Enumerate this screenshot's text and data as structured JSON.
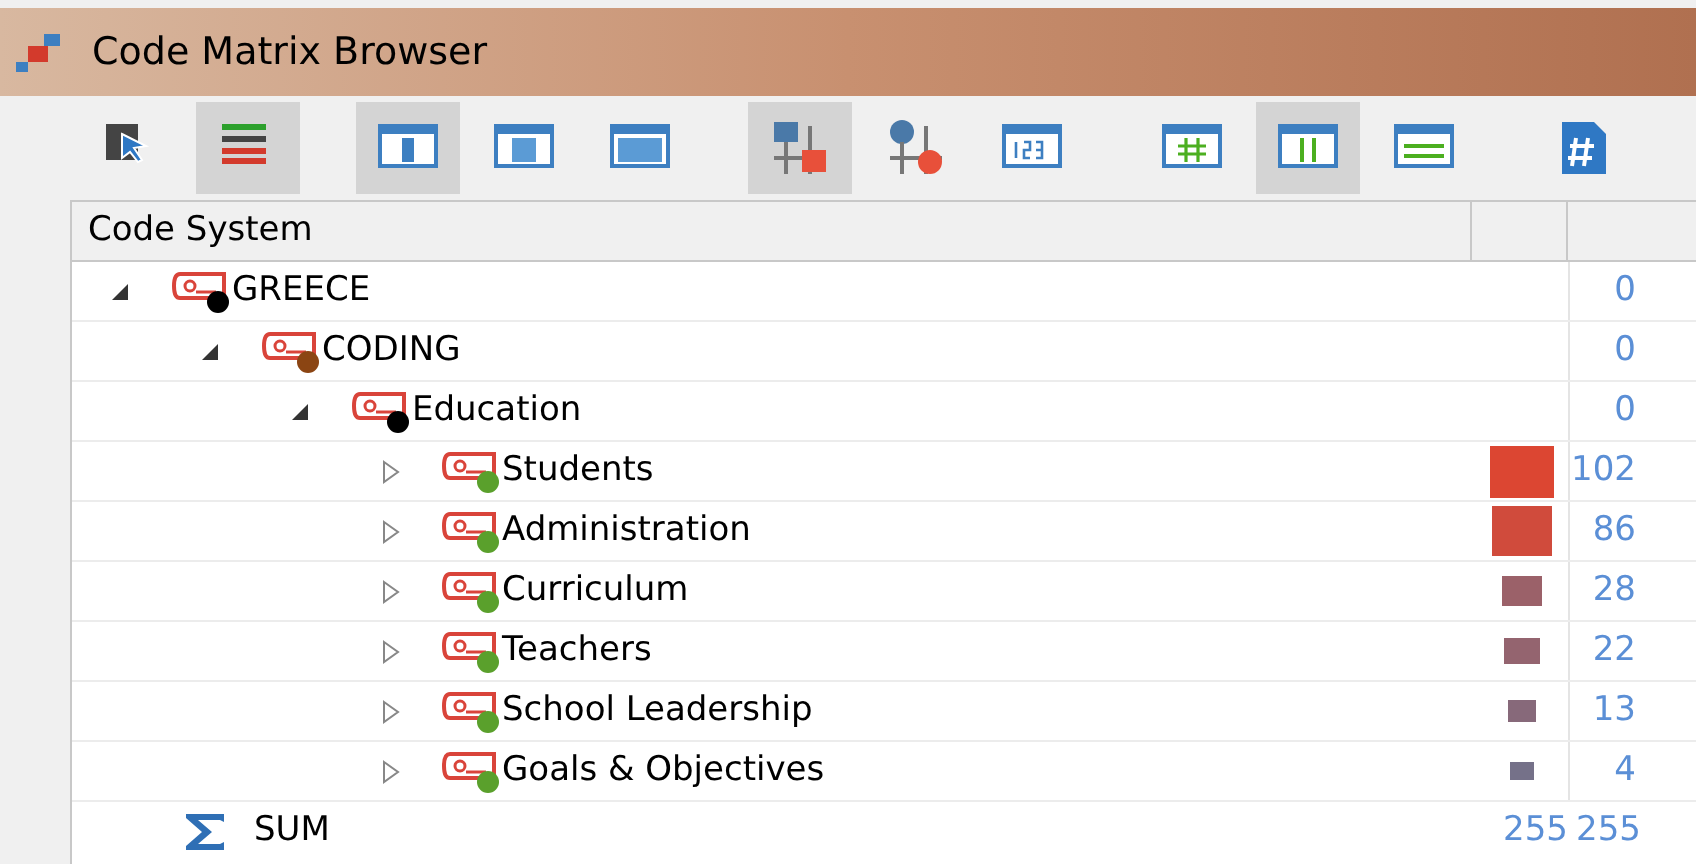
{
  "window": {
    "title": "Code Matrix Browser"
  },
  "toolbar": [
    {
      "buttons": [
        {
          "kind": "select",
          "selected": false
        },
        {
          "kind": "lines",
          "selected": true
        }
      ]
    },
    {
      "buttons": [
        {
          "kind": "pane-narrow",
          "selected": true
        },
        {
          "kind": "pane-square",
          "selected": false
        },
        {
          "kind": "pane-wide",
          "selected": false
        }
      ]
    },
    {
      "buttons": [
        {
          "kind": "squares",
          "selected": true
        },
        {
          "kind": "circles",
          "selected": false
        },
        {
          "kind": "numbers",
          "selected": false
        }
      ]
    },
    {
      "buttons": [
        {
          "kind": "grid",
          "selected": false
        },
        {
          "kind": "columns",
          "selected": true
        },
        {
          "kind": "rows",
          "selected": false
        }
      ]
    },
    {
      "buttons": [
        {
          "kind": "hash",
          "selected": false
        }
      ]
    }
  ],
  "table": {
    "columns": [
      "Code System"
    ],
    "tree": [
      {
        "label": "GREECE",
        "color": "#000000",
        "count": "0",
        "expanded": true,
        "children": [
          {
            "label": "CODING",
            "color": "#8b4513",
            "count": "0",
            "expanded": true,
            "children": [
              {
                "label": "Education",
                "color": "#000000",
                "count": "0",
                "expanded": true,
                "children": [
                  {
                    "label": "Students",
                    "color": "#5aa02c",
                    "count": "102",
                    "expanded": false
                  },
                  {
                    "label": "Administration",
                    "color": "#5aa02c",
                    "count": "86",
                    "expanded": false
                  },
                  {
                    "label": "Curriculum",
                    "color": "#5aa02c",
                    "count": "28",
                    "expanded": false
                  },
                  {
                    "label": "Teachers",
                    "color": "#5aa02c",
                    "count": "22",
                    "expanded": false
                  },
                  {
                    "label": "School Leadership",
                    "color": "#5aa02c",
                    "count": "13",
                    "expanded": false
                  },
                  {
                    "label": "Goals & Objectives",
                    "color": "#5aa02c",
                    "count": "4",
                    "expanded": false
                  }
                ]
              }
            ]
          }
        ]
      }
    ],
    "sum": {
      "label": "SUM",
      "values": [
        "255",
        "255"
      ]
    }
  }
}
